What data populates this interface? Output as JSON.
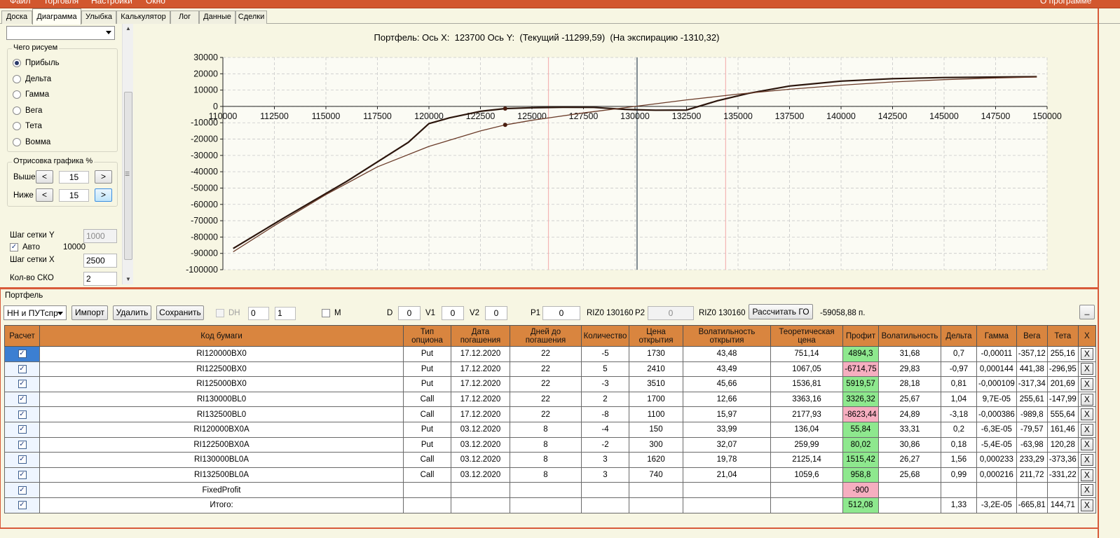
{
  "menu": {
    "items": [
      "Файл",
      "Торговля",
      "Настройки",
      "Окно"
    ],
    "about": "О программе"
  },
  "tabs": [
    "Доска",
    "Диаграмма",
    "Улыбка",
    "Калькулятор",
    "Лог",
    "Данные",
    "Сделки"
  ],
  "active_tab": "Диаграмма",
  "left_panel": {
    "combo_value": "",
    "draw_group": {
      "title": "Чего рисуем",
      "options": [
        "Прибыль",
        "Дельта",
        "Гамма",
        "Вега",
        "Тета",
        "Вомма"
      ],
      "selected": "Прибыль"
    },
    "range_group": {
      "title": "Отрисовка графика %",
      "above_label": "Выше",
      "above_value": "15",
      "below_label": "Ниже",
      "below_value": "15",
      "dec_label": "<",
      "inc_label": ">"
    },
    "grid_step_y_label": "Шаг сетки Y",
    "grid_step_y_value": "1000",
    "auto_label": "Авто",
    "auto_checked": true,
    "auto_value": "10000",
    "grid_step_x_label": "Шаг сетки X",
    "grid_step_x_value": "2500",
    "sko_label": "Кол-во СКО",
    "sko_value": "2"
  },
  "chart_header": {
    "label": "Портфель: Ось X:  123700 Ось Y:  (Текущий -11299,59)  (На экспирацию -1310,32)"
  },
  "chart_data": {
    "type": "line",
    "xlim": [
      110000,
      150000
    ],
    "ylim": [
      -100000,
      30000
    ],
    "x_ticks": [
      110000,
      112500,
      115000,
      117500,
      120000,
      122500,
      125000,
      127500,
      130000,
      132500,
      135000,
      137500,
      140000,
      142500,
      145000,
      147500,
      150000
    ],
    "y_ticks": [
      30000,
      20000,
      10000,
      0,
      -10000,
      -20000,
      -30000,
      -40000,
      -50000,
      -60000,
      -70000,
      -80000,
      -90000,
      -100000
    ],
    "grid": true,
    "vertical_markers": [
      {
        "x": 125800,
        "color": "#f4b4b4"
      },
      {
        "x": 130100,
        "color": "#7f8a90"
      },
      {
        "x": 134400,
        "color": "#f4b4b4"
      }
    ],
    "series": [
      {
        "color": "#2b150c",
        "x": [
          110500,
          113000,
          116000,
          119000,
          120000,
          121000,
          122500,
          123700,
          125000,
          126500,
          128000,
          129500,
          130000,
          131000,
          132500,
          134000,
          135500,
          137500,
          140000,
          142500,
          145000,
          147500,
          149500
        ],
        "y": [
          -87000,
          -68000,
          -46000,
          -22000,
          -10500,
          -7000,
          -3000,
          -1300,
          -800,
          -500,
          -600,
          -1800,
          -2000,
          -2300,
          -2200,
          3500,
          8000,
          12500,
          15500,
          17000,
          17700,
          18000,
          18200
        ]
      },
      {
        "color": "#6b3c2a",
        "x": [
          110500,
          112500,
          115000,
          117500,
          120000,
          122500,
          123700,
          125000,
          127500,
          130000,
          132500,
          135000,
          137500,
          140000,
          142500,
          145000,
          147500,
          149500
        ],
        "y": [
          -89000,
          -73000,
          -54000,
          -37000,
          -24500,
          -15000,
          -11300,
          -8500,
          -4000,
          0,
          4000,
          7500,
          10500,
          13000,
          15000,
          16400,
          17400,
          18000
        ]
      }
    ],
    "points": [
      {
        "x": 123700,
        "y": -1300
      },
      {
        "x": 123700,
        "y": -11300
      }
    ]
  },
  "portfolio": {
    "label": "Портфель",
    "selector": "НН и ПУТспр",
    "import_btn": "Импорт",
    "delete_btn": "Удалить",
    "save_btn": "Сохранить",
    "dh_label": "DH",
    "spin1": "0",
    "spin2": "1",
    "m_label": "M",
    "d_label": "D",
    "d_value": "0",
    "v1_label": "V1",
    "v1_value": "0",
    "v2_label": "V2",
    "v2_value": "0",
    "p1_label": "P1",
    "p1_value": "0",
    "riz1": "RIZ0 130160",
    "p2_label": "P2",
    "p2_value": "0",
    "riz2": "RIZ0 130160",
    "calc_btn": "Рассчитать ГО",
    "go_value": "-59058,88 п.",
    "collapse_btn": "_"
  },
  "table": {
    "columns": [
      "Расчет",
      "Код бумаги",
      "Тип опциона",
      "Дата погашения",
      "Дней до погашения",
      "Количество",
      "Цена открытия",
      "Волатильность открытия",
      "Теоретическая цена",
      "Профит",
      "Волатильность",
      "Дельта",
      "Гамма",
      "Вега",
      "Тета",
      "X"
    ],
    "rows": [
      {
        "code": "RI120000BX0",
        "type": "Put",
        "date": "17.12.2020",
        "days": "22",
        "qty": "-5",
        "price": "1730",
        "vol_open": "43,48",
        "theo": "751,14",
        "profit": "4894,3",
        "profit_sign": "pos",
        "vol": "31,68",
        "delta": "0,7",
        "gamma": "-0,00011",
        "vega": "-357,12",
        "theta": "255,16"
      },
      {
        "code": "RI122500BX0",
        "type": "Put",
        "date": "17.12.2020",
        "days": "22",
        "qty": "5",
        "price": "2410",
        "vol_open": "43,49",
        "theo": "1067,05",
        "profit": "-6714,75",
        "profit_sign": "neg",
        "vol": "29,83",
        "delta": "-0,97",
        "gamma": "0,000144",
        "vega": "441,38",
        "theta": "-296,95"
      },
      {
        "code": "RI125000BX0",
        "type": "Put",
        "date": "17.12.2020",
        "days": "22",
        "qty": "-3",
        "price": "3510",
        "vol_open": "45,66",
        "theo": "1536,81",
        "profit": "5919,57",
        "profit_sign": "pos",
        "vol": "28,18",
        "delta": "0,81",
        "gamma": "-0,000109",
        "vega": "-317,34",
        "theta": "201,69"
      },
      {
        "code": "RI130000BL0",
        "type": "Call",
        "date": "17.12.2020",
        "days": "22",
        "qty": "2",
        "price": "1700",
        "vol_open": "12,66",
        "theo": "3363,16",
        "profit": "3326,32",
        "profit_sign": "pos",
        "vol": "25,67",
        "delta": "1,04",
        "gamma": "9,7E-05",
        "vega": "255,61",
        "theta": "-147,99"
      },
      {
        "code": "RI132500BL0",
        "type": "Call",
        "date": "17.12.2020",
        "days": "22",
        "qty": "-8",
        "price": "1100",
        "vol_open": "15,97",
        "theo": "2177,93",
        "profit": "-8623,44",
        "profit_sign": "neg",
        "vol": "24,89",
        "delta": "-3,18",
        "gamma": "-0,000386",
        "vega": "-989,8",
        "theta": "555,64"
      },
      {
        "code": "RI120000BX0A",
        "type": "Put",
        "date": "03.12.2020",
        "days": "8",
        "qty": "-4",
        "price": "150",
        "vol_open": "33,99",
        "theo": "136,04",
        "profit": "55,84",
        "profit_sign": "pos",
        "vol": "33,31",
        "delta": "0,2",
        "gamma": "-6,3E-05",
        "vega": "-79,57",
        "theta": "161,46"
      },
      {
        "code": "RI122500BX0A",
        "type": "Put",
        "date": "03.12.2020",
        "days": "8",
        "qty": "-2",
        "price": "300",
        "vol_open": "32,07",
        "theo": "259,99",
        "profit": "80,02",
        "profit_sign": "pos",
        "vol": "30,86",
        "delta": "0,18",
        "gamma": "-5,4E-05",
        "vega": "-63,98",
        "theta": "120,28"
      },
      {
        "code": "RI130000BL0A",
        "type": "Call",
        "date": "03.12.2020",
        "days": "8",
        "qty": "3",
        "price": "1620",
        "vol_open": "19,78",
        "theo": "2125,14",
        "profit": "1515,42",
        "profit_sign": "pos",
        "vol": "26,27",
        "delta": "1,56",
        "gamma": "0,000233",
        "vega": "233,29",
        "theta": "-373,36"
      },
      {
        "code": "RI132500BL0A",
        "type": "Call",
        "date": "03.12.2020",
        "days": "8",
        "qty": "3",
        "price": "740",
        "vol_open": "21,04",
        "theo": "1059,6",
        "profit": "958,8",
        "profit_sign": "pos",
        "vol": "25,68",
        "delta": "0,99",
        "gamma": "0,000216",
        "vega": "211,72",
        "theta": "-331,22"
      },
      {
        "code": "FixedProfit",
        "type": "",
        "date": "",
        "days": "",
        "qty": "",
        "price": "",
        "vol_open": "",
        "theo": "",
        "profit": "-900",
        "profit_sign": "neg",
        "vol": "",
        "delta": "",
        "gamma": "",
        "vega": "",
        "theta": ""
      },
      {
        "code": "Итого:",
        "type": "",
        "date": "",
        "days": "",
        "qty": "",
        "price": "",
        "vol_open": "",
        "theo": "",
        "profit": "512,08",
        "profit_sign": "pos",
        "vol": "",
        "delta": "1,33",
        "gamma": "-3,2E-05",
        "vega": "-665,81",
        "theta": "144,71"
      }
    ],
    "delete_label": "X",
    "check_mark": "✓"
  },
  "colors": {
    "accent": "#d2572e",
    "header": "#d9853f",
    "panel_bg": "#f7f6e3",
    "profit_pos": "#8ee88e",
    "profit_neg": "#f6aec0"
  }
}
